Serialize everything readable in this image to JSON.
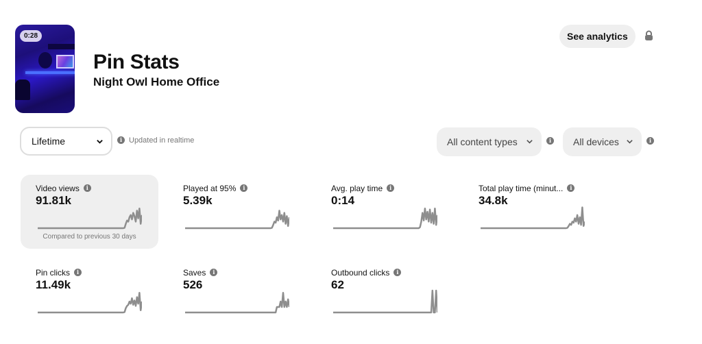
{
  "pin": {
    "duration": "0:28",
    "title": "Pin Stats",
    "subtitle": "Night Owl Home Office"
  },
  "header": {
    "see_analytics_label": "See analytics",
    "lock_icon": "lock-icon"
  },
  "filters": {
    "date_range": {
      "selected": "Lifetime"
    },
    "updated_note": "Updated in realtime",
    "content_type": {
      "selected": "All content types"
    },
    "devices": {
      "selected": "All devices"
    }
  },
  "metrics": [
    {
      "label": "Video views",
      "value": "91.81k",
      "active": true,
      "compare": "Compared to previous 30 days",
      "spark": [
        0,
        0,
        0,
        0,
        0,
        0,
        0,
        0,
        0,
        0,
        0,
        0,
        0,
        0,
        0,
        0,
        0,
        0,
        0,
        0,
        0,
        0,
        0,
        0,
        0,
        0,
        0,
        0,
        0,
        0,
        0,
        0,
        0,
        0,
        0,
        0,
        0,
        0,
        0,
        0,
        0,
        0,
        0,
        0,
        0,
        0,
        0,
        0,
        0,
        0,
        0,
        0,
        0,
        0,
        0,
        0,
        0,
        0,
        0,
        0,
        0,
        0,
        0,
        0,
        0,
        0,
        0,
        0,
        0,
        0,
        0.02,
        0.2,
        0.35,
        0.3,
        0.5,
        0.6,
        0.4,
        0.7,
        0.55,
        0.3,
        0.8,
        0.45,
        0.9,
        0.2,
        0.6
      ]
    },
    {
      "label": "Played at 95%",
      "value": "5.39k",
      "active": false,
      "spark": [
        0,
        0,
        0,
        0,
        0,
        0,
        0,
        0,
        0,
        0,
        0,
        0,
        0,
        0,
        0,
        0,
        0,
        0,
        0,
        0,
        0,
        0,
        0,
        0,
        0,
        0,
        0,
        0,
        0,
        0,
        0,
        0,
        0,
        0,
        0,
        0,
        0,
        0,
        0,
        0,
        0,
        0,
        0,
        0,
        0,
        0,
        0,
        0,
        0,
        0,
        0,
        0,
        0,
        0,
        0,
        0,
        0,
        0,
        0,
        0,
        0,
        0,
        0,
        0,
        0,
        0,
        0,
        0,
        0,
        0,
        0.02,
        0.15,
        0.3,
        0.25,
        0.5,
        0.35,
        0.8,
        0.4,
        0.6,
        0.3,
        0.7,
        0.2,
        0.55,
        0.1,
        0.5
      ]
    },
    {
      "label": "Avg. play time",
      "value": "0:14",
      "active": false,
      "spark": [
        0,
        0,
        0,
        0,
        0,
        0,
        0,
        0,
        0,
        0,
        0,
        0,
        0,
        0,
        0,
        0,
        0,
        0,
        0,
        0,
        0,
        0,
        0,
        0,
        0,
        0,
        0,
        0,
        0,
        0,
        0,
        0,
        0,
        0,
        0,
        0,
        0,
        0,
        0,
        0,
        0,
        0,
        0,
        0,
        0,
        0,
        0,
        0,
        0,
        0,
        0,
        0,
        0,
        0,
        0,
        0,
        0,
        0,
        0,
        0,
        0,
        0,
        0,
        0,
        0,
        0,
        0,
        0,
        0,
        0,
        0.05,
        0.3,
        0.7,
        0.35,
        0.9,
        0.4,
        0.75,
        0.3,
        0.85,
        0.25,
        0.7,
        0.2,
        0.9,
        0.15,
        0.6
      ]
    },
    {
      "label": "Total play time (minut...",
      "value": "34.8k",
      "active": false,
      "spark": [
        0,
        0,
        0,
        0,
        0,
        0,
        0,
        0,
        0,
        0,
        0,
        0,
        0,
        0,
        0,
        0,
        0,
        0,
        0,
        0,
        0,
        0,
        0,
        0,
        0,
        0,
        0,
        0,
        0,
        0,
        0,
        0,
        0,
        0,
        0,
        0,
        0,
        0,
        0,
        0,
        0,
        0,
        0,
        0,
        0,
        0,
        0,
        0,
        0,
        0,
        0,
        0,
        0,
        0,
        0,
        0,
        0,
        0,
        0,
        0,
        0,
        0,
        0,
        0,
        0,
        0,
        0,
        0,
        0,
        0,
        0.02,
        0.1,
        0.2,
        0.15,
        0.3,
        0.25,
        0.45,
        0.3,
        0.6,
        0.2,
        0.5,
        0.15,
        0.95,
        0.1,
        0.3
      ]
    },
    {
      "label": "Pin clicks",
      "value": "11.49k",
      "active": false,
      "spark": [
        0,
        0,
        0,
        0,
        0,
        0,
        0,
        0,
        0,
        0,
        0,
        0,
        0,
        0,
        0,
        0,
        0,
        0,
        0,
        0,
        0,
        0,
        0,
        0,
        0,
        0,
        0,
        0,
        0,
        0,
        0,
        0,
        0,
        0,
        0,
        0,
        0,
        0,
        0,
        0,
        0,
        0,
        0,
        0,
        0,
        0,
        0,
        0,
        0,
        0,
        0,
        0,
        0,
        0,
        0,
        0,
        0,
        0,
        0,
        0,
        0,
        0,
        0,
        0,
        0,
        0,
        0,
        0,
        0,
        0,
        0.02,
        0.2,
        0.3,
        0.35,
        0.5,
        0.4,
        0.65,
        0.35,
        0.55,
        0.3,
        0.7,
        0.4,
        0.9,
        0.1,
        0.5
      ]
    },
    {
      "label": "Saves",
      "value": "526",
      "active": false,
      "spark": [
        0,
        0,
        0,
        0,
        0,
        0,
        0,
        0,
        0,
        0,
        0,
        0,
        0,
        0,
        0,
        0,
        0,
        0,
        0,
        0,
        0,
        0,
        0,
        0,
        0,
        0,
        0,
        0,
        0,
        0,
        0,
        0,
        0,
        0,
        0,
        0,
        0,
        0,
        0,
        0,
        0,
        0,
        0,
        0,
        0,
        0,
        0,
        0,
        0,
        0,
        0,
        0,
        0,
        0,
        0,
        0,
        0,
        0,
        0,
        0,
        0,
        0,
        0,
        0,
        0,
        0,
        0,
        0,
        0,
        0,
        0,
        0,
        0,
        0,
        0.25,
        0.25,
        0.25,
        0.5,
        0.25,
        0.9,
        0.25,
        0.5,
        0.25,
        0.6,
        0.25
      ]
    },
    {
      "label": "Outbound clicks",
      "value": "62",
      "active": false,
      "spark": [
        0,
        0,
        0,
        0,
        0,
        0,
        0,
        0,
        0,
        0,
        0,
        0,
        0,
        0,
        0,
        0,
        0,
        0,
        0,
        0,
        0,
        0,
        0,
        0,
        0,
        0,
        0,
        0,
        0,
        0,
        0,
        0,
        0,
        0,
        0,
        0,
        0,
        0,
        0,
        0,
        0,
        0,
        0,
        0,
        0,
        0,
        0,
        0,
        0,
        0,
        0,
        0,
        0,
        0,
        0,
        0,
        0,
        0,
        0,
        0,
        0,
        0,
        0,
        0,
        0,
        0,
        0,
        0,
        0,
        0,
        0,
        0,
        0,
        0,
        0,
        0,
        0,
        0,
        0,
        0,
        1,
        0,
        0,
        1,
        0
      ]
    }
  ],
  "colors": {
    "spark": "#8e8e8e",
    "active_card_bg": "#efefef",
    "pill_bg": "#efefef",
    "muted_text": "#767676"
  }
}
